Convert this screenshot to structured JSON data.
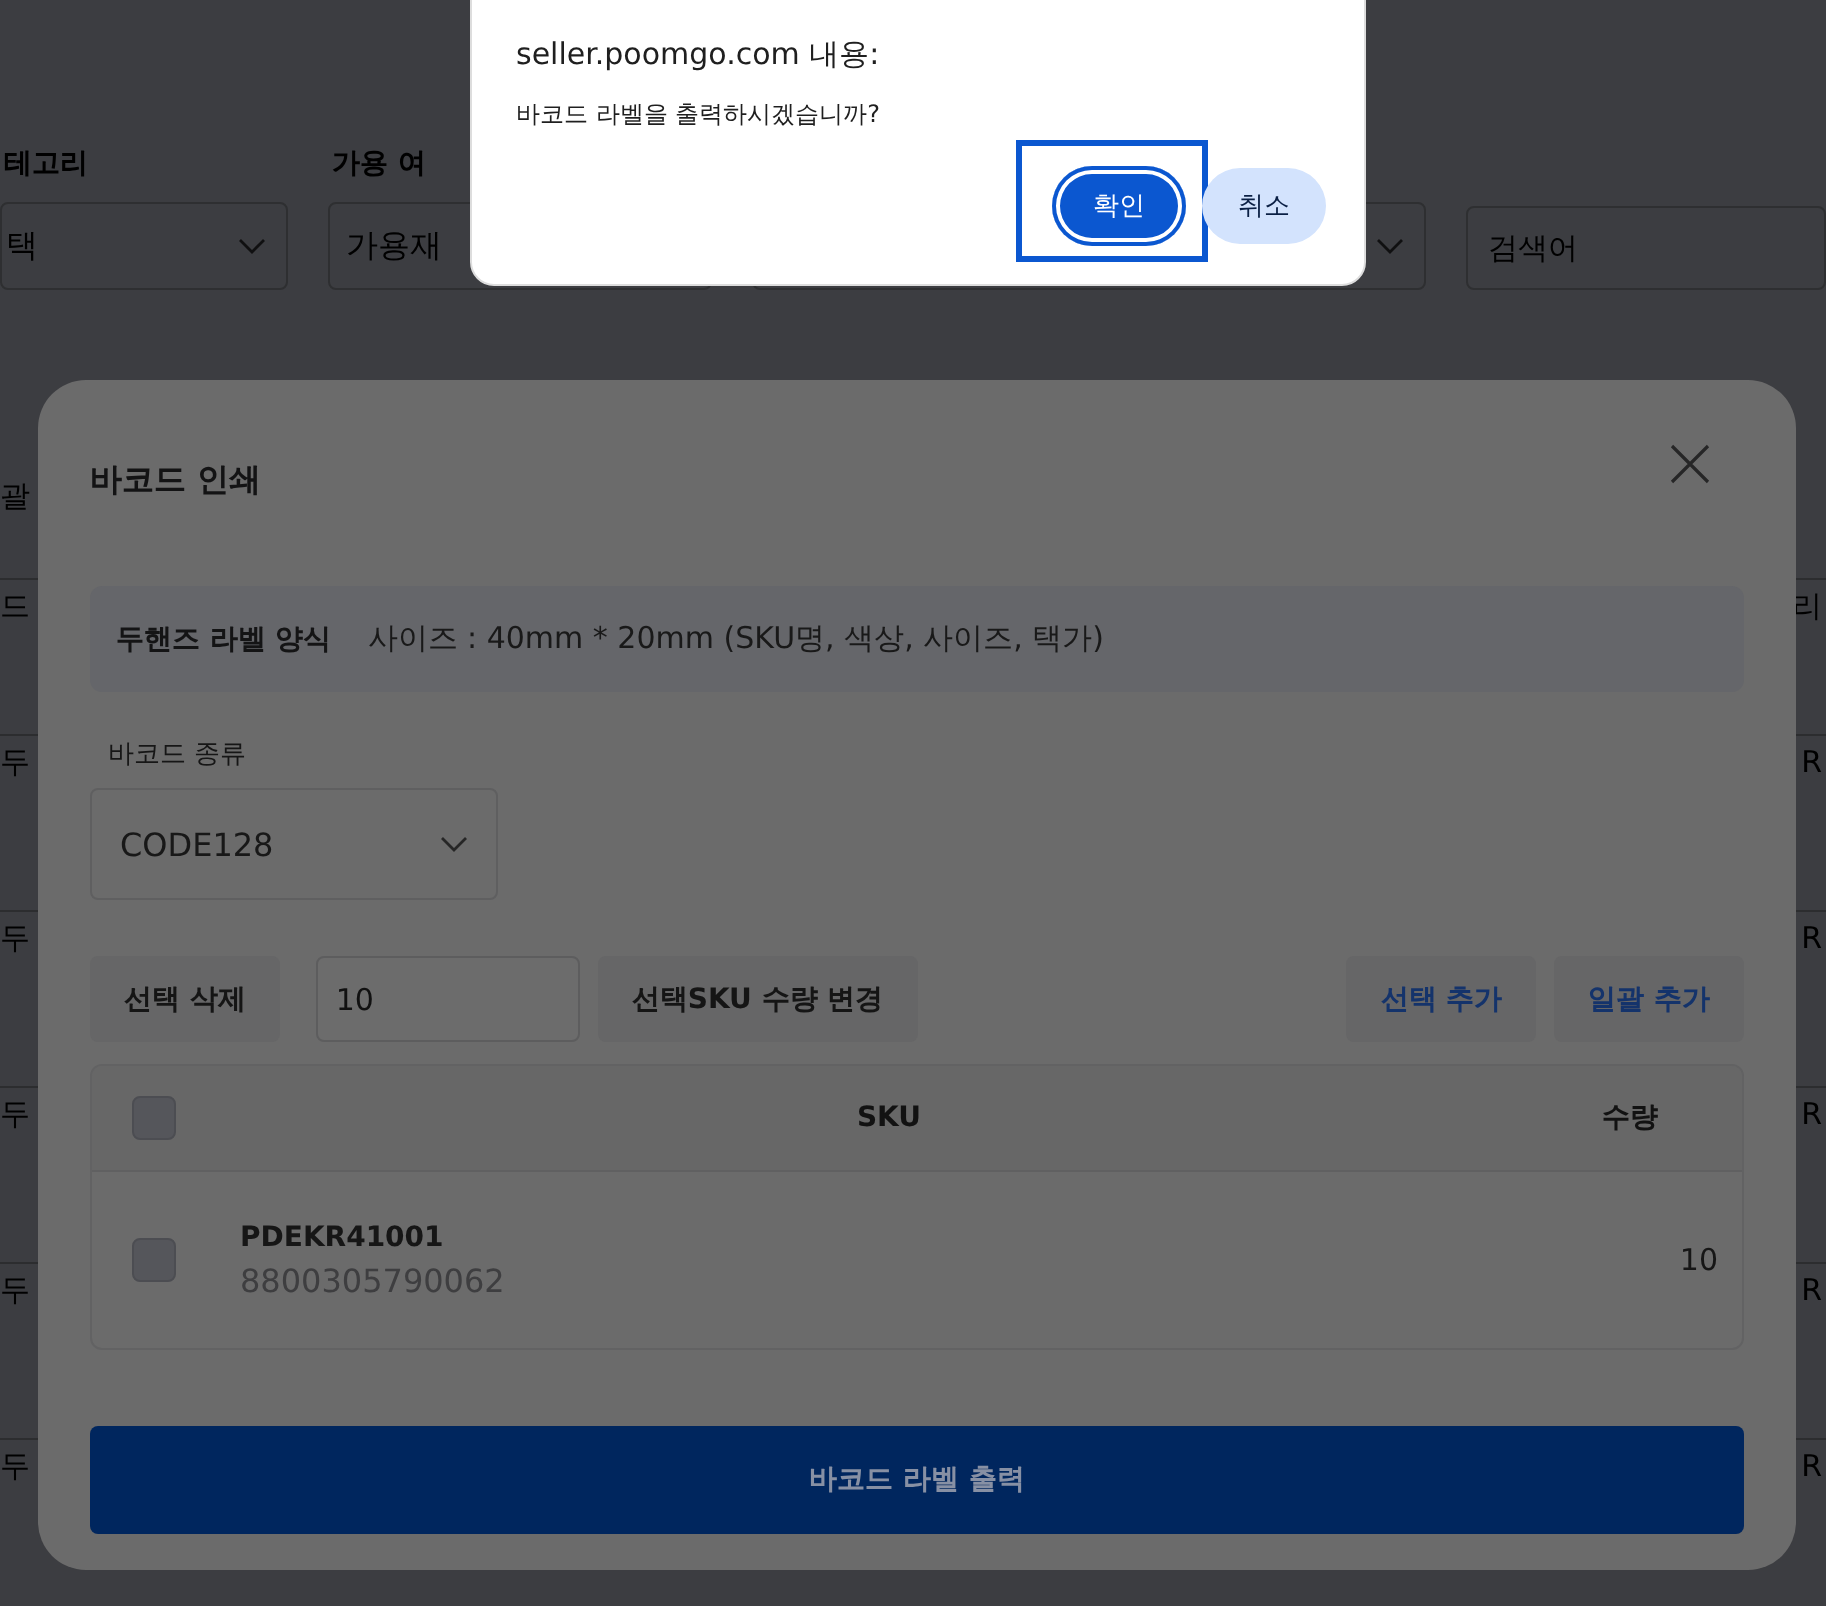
{
  "background_page": {
    "filters": [
      {
        "label": "테고리",
        "value": "택"
      },
      {
        "label": "가용 여",
        "value": "가용재"
      }
    ],
    "search": {
      "placeholder": "검색어"
    },
    "rows": [
      {
        "left": "괄"
      },
      {
        "left": "드",
        "right": "리"
      },
      {
        "left": "두",
        "right": "R"
      },
      {
        "left": "두",
        "right": "R"
      },
      {
        "left": "두",
        "right": "R"
      },
      {
        "left": "두",
        "right": "R"
      },
      {
        "left": "두",
        "right": "R"
      }
    ]
  },
  "modal": {
    "title": "바코드 인쇄",
    "label_format": {
      "name": "두핸즈 라벨 양식",
      "description": "사이즈 : 40mm * 20mm (SKU명, 색상, 사이즈, 택가)"
    },
    "barcode_type": {
      "label": "바코드 종류",
      "value": "CODE128"
    },
    "toolbar": {
      "delete_button": "선택 삭제",
      "quantity": "10",
      "change_button": "선택SKU 수량 변경",
      "add_selected_button": "선택 추가",
      "add_all_button": "일괄 추가"
    },
    "table": {
      "header_checked": false,
      "columns": [
        "SKU",
        "수량"
      ],
      "rows": [
        {
          "checked": false,
          "sku": "PDEKR41001",
          "barcode": "8800305790062",
          "quantity": "10"
        }
      ]
    },
    "print_button": "바코드 라벨 출력"
  },
  "alert": {
    "title": "seller.poomgo.com 내용:",
    "message": "바코드 라벨을 출력하시겠습니까?",
    "ok_button": "확인",
    "cancel_button": "취소"
  }
}
